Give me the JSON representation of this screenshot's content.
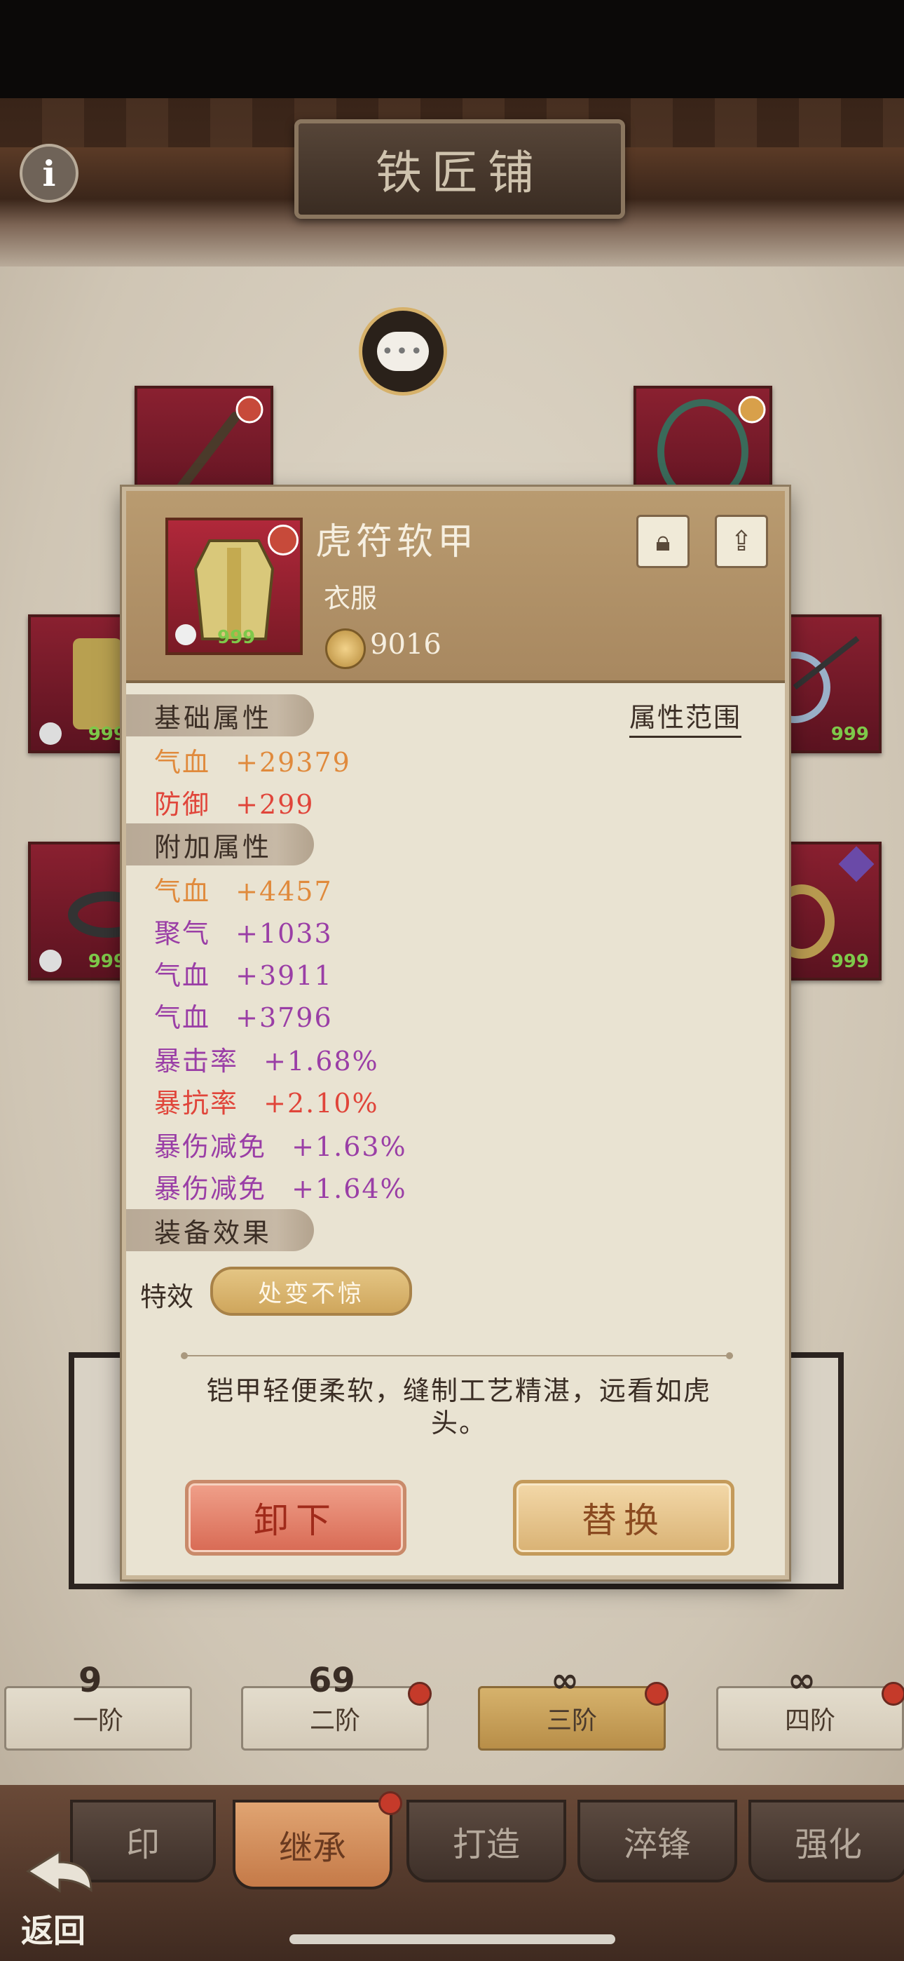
{
  "header": {
    "title": "铁匠铺"
  },
  "info_icon": "info-icon",
  "chat_icon": "chat-bubble-icon",
  "slots": {
    "count_label": "999"
  },
  "tiers": [
    {
      "label": "一阶",
      "icon": "9"
    },
    {
      "label": "二阶",
      "icon": "69"
    },
    {
      "label": "三阶",
      "icon": "∞"
    },
    {
      "label": "四阶",
      "icon": "∞"
    }
  ],
  "bottom_nav": {
    "tabs": [
      "印",
      "继承",
      "打造",
      "淬锋",
      "强化"
    ],
    "active": "继承",
    "back_label": "返回"
  },
  "item": {
    "name": "虎符软甲",
    "type": "衣服",
    "power": "9016",
    "icon_count": "999",
    "range_link": "属性范围",
    "base_section": "基础属性",
    "base_attrs": [
      {
        "name": "气血",
        "value": "+29379",
        "color": "#e08a3c"
      },
      {
        "name": "防御",
        "value": "+299",
        "color": "#e0453a"
      }
    ],
    "extra_section": "附加属性",
    "extra_attrs": [
      {
        "name": "气血",
        "value": "+4457",
        "color": "#e08a3c"
      },
      {
        "name": "聚气",
        "value": "+1033",
        "color": "#9a3ea6"
      },
      {
        "name": "气血",
        "value": "+3911",
        "color": "#9a3ea6"
      },
      {
        "name": "气血",
        "value": "+3796",
        "color": "#9a3ea6"
      },
      {
        "name": "暴击率",
        "value": "+1.68%",
        "color": "#9a3ea6"
      },
      {
        "name": "暴抗率",
        "value": "+2.10%",
        "color": "#e0453a"
      },
      {
        "name": "暴伤减免",
        "value": "+1.63%",
        "color": "#9a3ea6"
      },
      {
        "name": "暴伤减免",
        "value": "+1.64%",
        "color": "#9a3ea6"
      }
    ],
    "effect_section": "装备效果",
    "effect_label": "特效",
    "effect_value": "处变不惊",
    "description": "铠甲轻便柔软，缝制工艺精湛，远看如虎头。",
    "unequip_label": "卸下",
    "replace_label": "替换"
  }
}
